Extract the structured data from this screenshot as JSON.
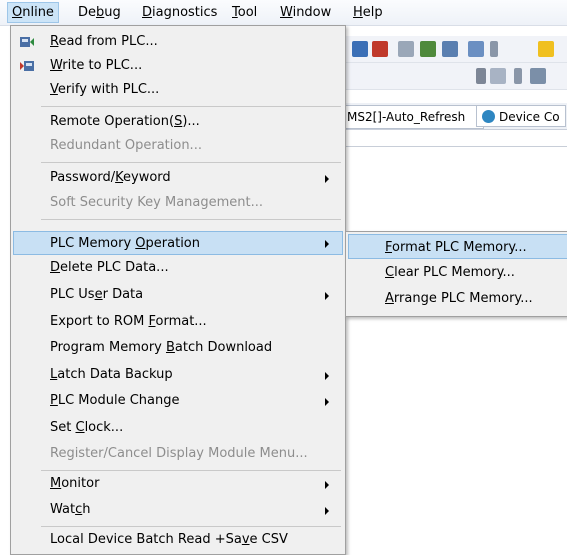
{
  "menubar": [
    {
      "pre": "",
      "acc": "O",
      "post": "nline"
    },
    {
      "pre": "De",
      "acc": "b",
      "post": "ug"
    },
    {
      "pre": "",
      "acc": "D",
      "post": "iagnostics"
    },
    {
      "pre": "",
      "acc": "T",
      "post": "ool"
    },
    {
      "pre": "",
      "acc": "W",
      "post": "indow"
    },
    {
      "pre": "",
      "acc": "H",
      "post": "elp"
    }
  ],
  "tabs": {
    "tab1": "MS2[]-Auto_Refresh",
    "tab2": "Device Co"
  },
  "menu": [
    {
      "pre": "",
      "acc": "R",
      "post": "ead from PLC...",
      "icon": "read-from-plc-icon"
    },
    {
      "pre": "",
      "acc": "W",
      "post": "rite to PLC...",
      "icon": "write-to-plc-icon"
    },
    {
      "pre": "",
      "acc": "V",
      "post": "erify with PLC..."
    },
    {
      "pre": "Remote Operation(",
      "acc": "S",
      "post": ")..."
    },
    {
      "pre": "Redundant Operation...",
      "acc": "",
      "post": "",
      "disabled": true
    },
    {
      "pre": "Password/",
      "acc": "K",
      "post": "eyword",
      "submenu": true
    },
    {
      "pre": "Soft Security Key Management...",
      "acc": "",
      "post": "",
      "disabled": true
    },
    {
      "pre": "PLC Memory ",
      "acc": "O",
      "post": "peration",
      "submenu": true,
      "highlight": true
    },
    {
      "pre": "",
      "acc": "D",
      "post": "elete PLC Data..."
    },
    {
      "pre": "PLC Us",
      "acc": "e",
      "post": "r Data",
      "submenu": true
    },
    {
      "pre": "Export to ROM ",
      "acc": "F",
      "post": "ormat..."
    },
    {
      "pre": "Program Memory ",
      "acc": "B",
      "post": "atch Download"
    },
    {
      "pre": "",
      "acc": "L",
      "post": "atch Data Backup",
      "submenu": true
    },
    {
      "pre": "",
      "acc": "P",
      "post": "LC Module Change",
      "submenu": true
    },
    {
      "pre": "Set ",
      "acc": "C",
      "post": "lock..."
    },
    {
      "pre": "Register/Cancel Display Module Menu...",
      "acc": "",
      "post": "",
      "disabled": true
    },
    {
      "pre": "",
      "acc": "M",
      "post": "onitor",
      "submenu": true
    },
    {
      "pre": "Wat",
      "acc": "c",
      "post": "h",
      "submenu": true
    },
    {
      "pre": "Local Device Batch Read +Sa",
      "acc": "v",
      "post": "e CSV"
    }
  ],
  "submenu": [
    {
      "pre": "",
      "acc": "F",
      "post": "ormat PLC Memory...",
      "highlight": true
    },
    {
      "pre": "",
      "acc": "C",
      "post": "lear PLC Memory..."
    },
    {
      "pre": "",
      "acc": "A",
      "post": "rrange PLC Memory..."
    }
  ],
  "colors": {
    "highlight_bg": "#c8e0f4",
    "highlight_border": "#8cbbe3",
    "menu_bg": "#f0f0f0",
    "disabled_text": "#8d8d8d"
  }
}
